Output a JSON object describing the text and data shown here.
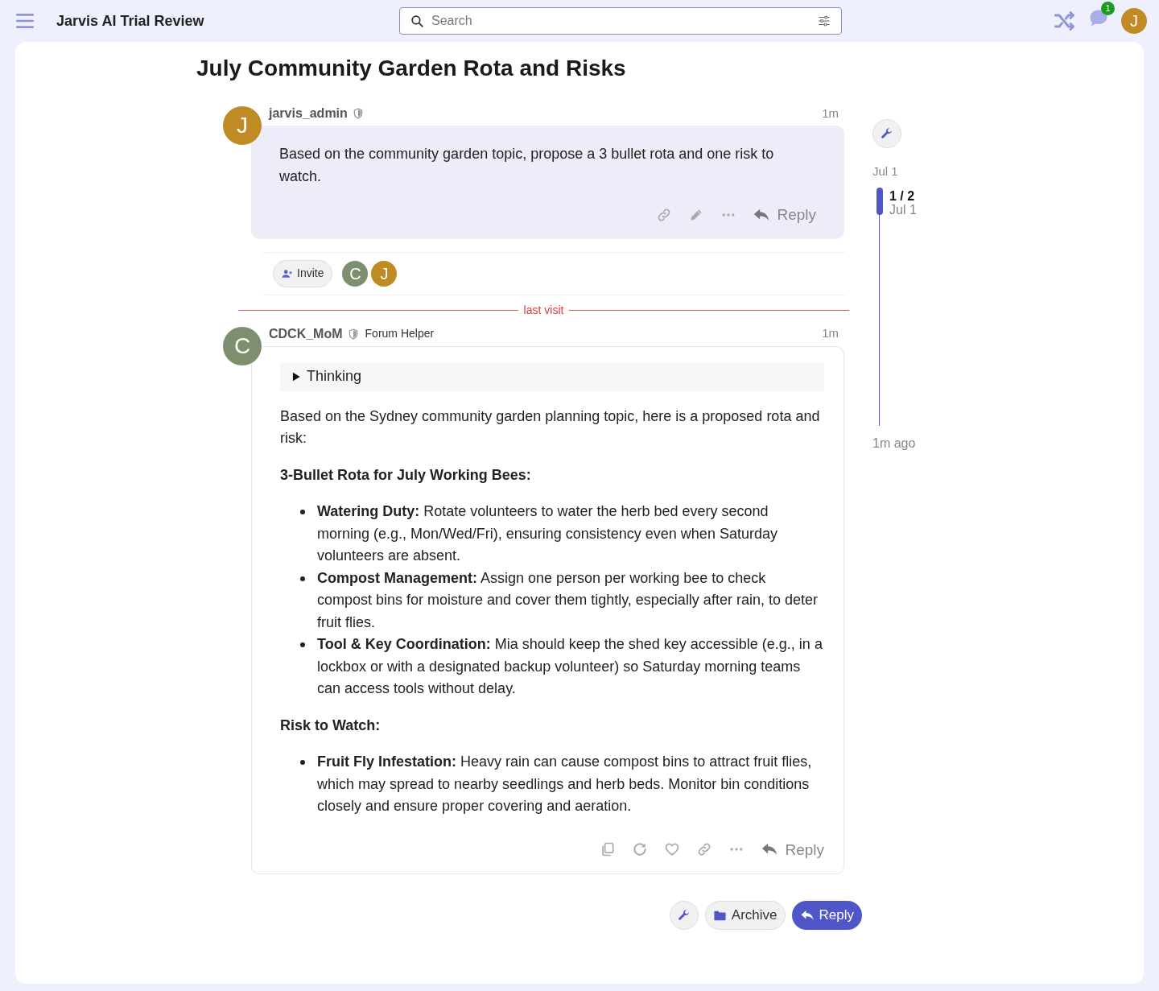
{
  "header": {
    "title": "Jarvis AI Trial Review",
    "search": {
      "placeholder": "Search"
    },
    "notification_count": "1",
    "avatar_letter": "J"
  },
  "topic": {
    "title": "July Community Garden Rota and Risks"
  },
  "posts": [
    {
      "kind": "user",
      "author": "jarvis_admin",
      "avatar_letter": "J",
      "color": "#c08a24",
      "time": "1m",
      "reply_label": "Reply",
      "blocks": [
        {
          "kind": "paragraph",
          "text": "Based on the community garden topic, propose a 3 bullet rota and one risk to watch."
        }
      ]
    },
    {
      "kind": "ai",
      "author": "CDCK_MoM",
      "avatar_letter": "C",
      "color": "#7e8f70",
      "role": "Forum Helper",
      "time": "1m",
      "reply_label": "Reply",
      "thinking": "Thinking",
      "blocks": [
        {
          "kind": "paragraph",
          "text": "Based on the Sydney community garden planning topic, here is a proposed rota and risk:"
        },
        {
          "kind": "heading",
          "text": "3-Bullet Rota for July Working Bees:"
        },
        {
          "kind": "list",
          "items": [
            "**Watering Duty:** Rotate volunteers to water the herb bed every second morning (e.g., Mon/Wed/Fri), ensuring consistency even when Saturday volunteers are absent.",
            "**Compost Management:** Assign one person per working bee to check compost bins for moisture and cover them tightly, especially after rain, to deter fruit flies.",
            "**Tool & Key Coordination:** Mia should keep the shed key accessible (e.g., in a lockbox or with a designated backup volunteer) so Saturday morning teams can access tools without delay."
          ]
        },
        {
          "kind": "heading",
          "text": "Risk to Watch:"
        },
        {
          "kind": "list",
          "items": [
            "**Fruit Fly Infestation:** Heavy rain can cause compost bins to attract fruit flies, which may spread to nearby seedlings and herb beds. Monitor bin conditions closely and ensure proper covering and aeration."
          ]
        }
      ]
    }
  ],
  "invite": {
    "label": "Invite",
    "participants": [
      {
        "letter": "C",
        "color": "#7e8f70"
      },
      {
        "letter": "J",
        "color": "#c08a24"
      }
    ]
  },
  "divider": "last visit",
  "timeline": {
    "start": "Jul 1",
    "position": "1 / 2",
    "position_date": "Jul 1",
    "end": "1m ago"
  },
  "footer_buttons": {
    "archive": "Archive",
    "reply": "Reply"
  }
}
